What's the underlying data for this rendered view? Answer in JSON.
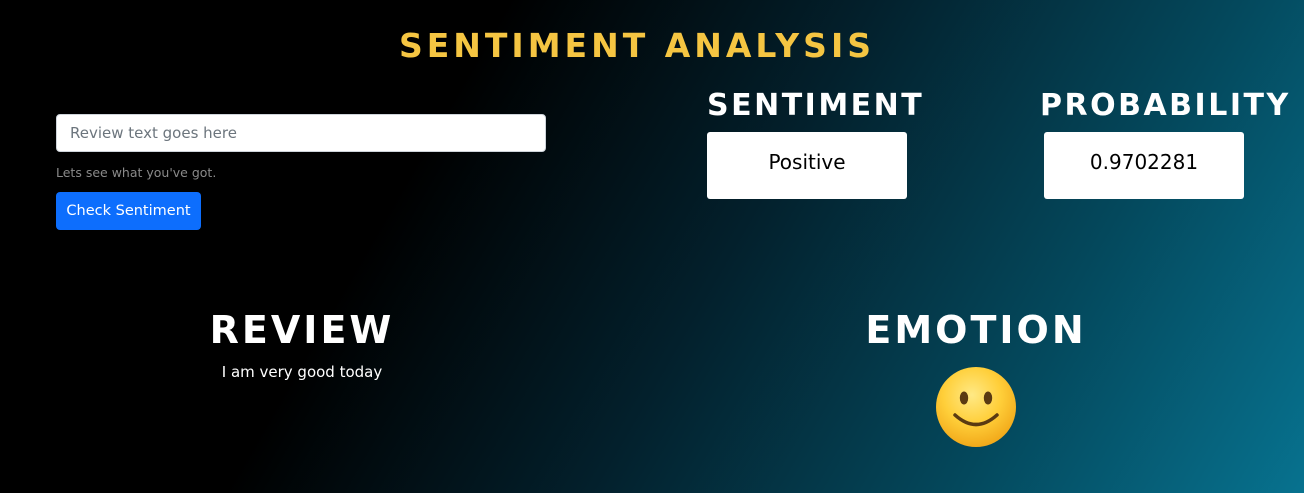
{
  "header": {
    "title": "SENTIMENT ANALYSIS"
  },
  "form": {
    "input_placeholder": "Review text goes here",
    "input_value": "",
    "help_text": "Lets see what you've got.",
    "submit_label": "Check Sentiment"
  },
  "results": {
    "sentiment_heading": "SENTIMENT",
    "sentiment_value": "Positive",
    "probability_heading": "PROBABILITY",
    "probability_value": "0.9702281"
  },
  "review": {
    "heading": "REVIEW",
    "text": "I am very good today"
  },
  "emotion": {
    "heading": "EMOTION",
    "icon": "slightly-smiling-face-icon"
  },
  "colors": {
    "title": "#f5c542",
    "button": "#0d6efd",
    "background_start": "#000000",
    "background_end": "#07728f"
  }
}
